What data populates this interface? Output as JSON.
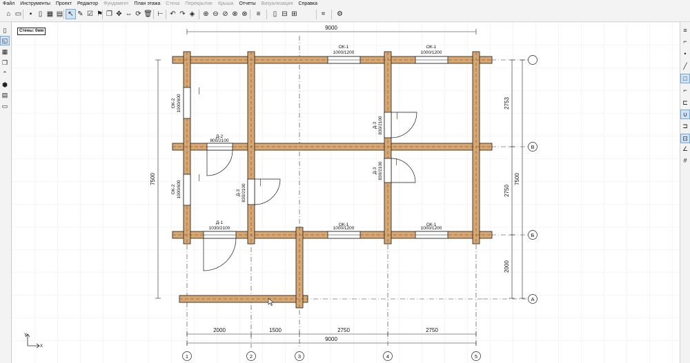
{
  "menu": {
    "items": [
      {
        "label": "Файл",
        "enabled": true
      },
      {
        "label": "Инструменты",
        "enabled": true
      },
      {
        "label": "Проект",
        "enabled": true
      },
      {
        "label": "Редактор",
        "enabled": true
      },
      {
        "label": "Фундамент",
        "enabled": false
      },
      {
        "label": "План этажа",
        "enabled": true
      },
      {
        "label": "Стена",
        "enabled": false
      },
      {
        "label": "Перекрытие",
        "enabled": false
      },
      {
        "label": "Крыша",
        "enabled": false
      },
      {
        "label": "Отчеты",
        "enabled": true
      },
      {
        "label": "Визуализация",
        "enabled": false
      },
      {
        "label": "Справка",
        "enabled": true
      }
    ]
  },
  "toolbar": {
    "buttons": [
      {
        "icon": "new-project-icon",
        "glyph": "⌂"
      },
      {
        "icon": "open-folder-icon",
        "glyph": "▭"
      },
      {
        "icon": "save-icon",
        "glyph": "▪"
      },
      {
        "icon": "book-icon",
        "glyph": "▯"
      },
      {
        "icon": "grid-icon",
        "glyph": "▦"
      },
      {
        "icon": "table-icon",
        "glyph": "▤"
      },
      {
        "icon": "select-arrow-icon",
        "glyph": "↖",
        "active": true
      },
      {
        "icon": "pencil-icon",
        "glyph": "✎"
      },
      {
        "icon": "checkbox-icon",
        "glyph": "☑"
      },
      {
        "icon": "flag-icon",
        "glyph": "⚑"
      },
      {
        "icon": "copy-icon",
        "glyph": "❐"
      },
      {
        "icon": "move-icon",
        "glyph": "✥"
      },
      {
        "icon": "mirror-icon",
        "glyph": "⇔"
      },
      {
        "icon": "rotate-icon",
        "glyph": "⟳"
      },
      {
        "icon": "delete-icon",
        "glyph": "🗑"
      },
      {
        "icon": "dimension-icon",
        "glyph": "⊢"
      },
      {
        "icon": "undo-icon",
        "glyph": "↶"
      },
      {
        "icon": "redo-icon",
        "glyph": "↷"
      },
      {
        "icon": "layers-icon",
        "glyph": "◈"
      },
      {
        "icon": "zoom-in-icon",
        "glyph": "⊕"
      },
      {
        "icon": "pan-left-icon",
        "glyph": "⊖"
      },
      {
        "icon": "pan-right-icon",
        "glyph": "⊘"
      },
      {
        "icon": "zoom-fit-icon",
        "glyph": "⊗"
      },
      {
        "icon": "cancel-icon",
        "glyph": "⊗"
      },
      {
        "icon": "list-icon",
        "glyph": "≡"
      },
      {
        "icon": "frame-icon",
        "glyph": "▯"
      },
      {
        "icon": "lines-icon",
        "glyph": "⊟"
      },
      {
        "icon": "window-icon",
        "glyph": "⊞"
      },
      {
        "icon": "crop-icon",
        "glyph": "⌗"
      },
      {
        "icon": "settings-icon",
        "glyph": "⚙"
      }
    ]
  },
  "left_panel": {
    "buttons": [
      {
        "icon": "page-icon",
        "glyph": "▯"
      },
      {
        "icon": "plan-view-icon",
        "glyph": "◱",
        "active": true
      },
      {
        "icon": "wall-icon",
        "glyph": "▦"
      },
      {
        "icon": "copy-layer-icon",
        "glyph": "❐"
      },
      {
        "icon": "roof-icon",
        "glyph": "⌃"
      },
      {
        "icon": "3d-view-icon",
        "glyph": "⬢"
      },
      {
        "icon": "grid-small-icon",
        "glyph": "▤"
      },
      {
        "icon": "stack-icon",
        "glyph": "▭"
      }
    ]
  },
  "right_panel": {
    "buttons": [
      {
        "icon": "menu-icon",
        "glyph": "≡"
      },
      {
        "icon": "polyline-icon",
        "glyph": "⌐"
      },
      {
        "icon": "point-icon",
        "glyph": "•"
      },
      {
        "icon": "line-icon",
        "glyph": "╱"
      },
      {
        "icon": "rectangle-icon",
        "glyph": "□",
        "active": true
      },
      {
        "icon": "step-icon",
        "glyph": "⌐"
      },
      {
        "icon": "stair-icon",
        "glyph": "⊏"
      },
      {
        "icon": "magnet-icon",
        "glyph": "∪",
        "active": true
      },
      {
        "icon": "snap-icon",
        "glyph": "⊐"
      },
      {
        "icon": "ortho-icon",
        "glyph": "⊡",
        "active": true
      },
      {
        "icon": "angle-icon",
        "glyph": "∠"
      },
      {
        "icon": "grid-snap-icon",
        "glyph": "#"
      }
    ]
  },
  "wall_indicator": "Стены: 0мм",
  "plan": {
    "wall_color": "#d9a66f",
    "openings": {
      "ok1": {
        "label": "ОК-1",
        "size": "1000/1200"
      },
      "ok2": {
        "label": "ОК-2",
        "size": "1000/600"
      },
      "d1": {
        "label": "Д-1",
        "size": "1030/2100"
      },
      "d2": {
        "label": "Д-2",
        "size": "800/2100"
      },
      "d3": {
        "label": "Д-3",
        "size": "830/2100"
      }
    },
    "dims_top": {
      "total": "9000"
    },
    "dims_bottom": {
      "segments": [
        "2000",
        "1500",
        "2750",
        "2750"
      ],
      "total": "9000"
    },
    "dims_left": {
      "total": "7500"
    },
    "dims_right": {
      "segments": [
        "2753",
        "2750",
        "2000"
      ],
      "total": "7500"
    },
    "axes_letters": [
      "",
      "В",
      "Б",
      "А"
    ],
    "axes_numbers": [
      "1",
      "2",
      "3",
      "4",
      "5"
    ],
    "ucs": {
      "x": "X",
      "y": "Y"
    }
  }
}
